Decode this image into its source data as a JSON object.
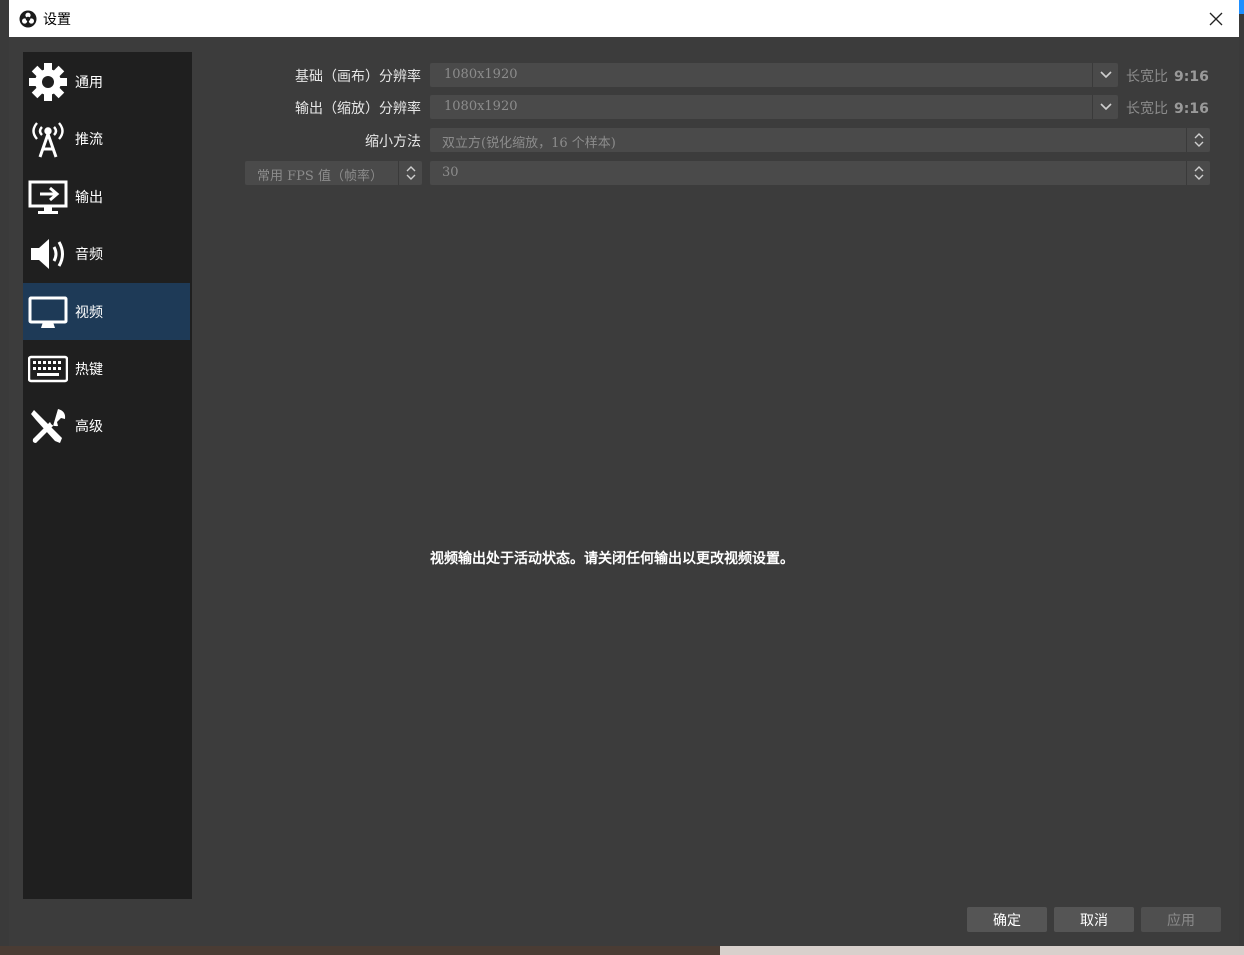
{
  "window": {
    "title": "设置"
  },
  "sidebar": {
    "items": [
      {
        "label": "通用",
        "icon": "gear-icon"
      },
      {
        "label": "推流",
        "icon": "broadcast-antenna-icon"
      },
      {
        "label": "输出",
        "icon": "monitor-output-icon"
      },
      {
        "label": "音频",
        "icon": "speaker-icon"
      },
      {
        "label": "视频",
        "icon": "monitor-icon",
        "selected": true
      },
      {
        "label": "热键",
        "icon": "keyboard-icon"
      },
      {
        "label": "高级",
        "icon": "wrench-screwdriver-icon"
      }
    ]
  },
  "video": {
    "base_resolution": {
      "label": "基础（画布）分辨率",
      "value": "1080x1920",
      "aspect_label": "长宽比",
      "aspect_value": "9:16"
    },
    "output_resolution": {
      "label": "输出（缩放）分辨率",
      "value": "1080x1920",
      "aspect_label": "长宽比",
      "aspect_value": "9:16"
    },
    "downscale_filter": {
      "label": "缩小方法",
      "value": "双立方(锐化缩放，16 个样本)"
    },
    "fps": {
      "type_value": "常用 FPS 值（帧率）",
      "value": "30"
    },
    "notice": "视频输出处于活动状态。请关闭任何输出以更改视频设置。"
  },
  "buttons": {
    "ok": "确定",
    "cancel": "取消",
    "apply": "应用"
  },
  "colors": {
    "selected_nav": "#1e3a57",
    "dialog_bg": "#3c3c3c",
    "sidebar_bg": "#1f1f1f"
  }
}
